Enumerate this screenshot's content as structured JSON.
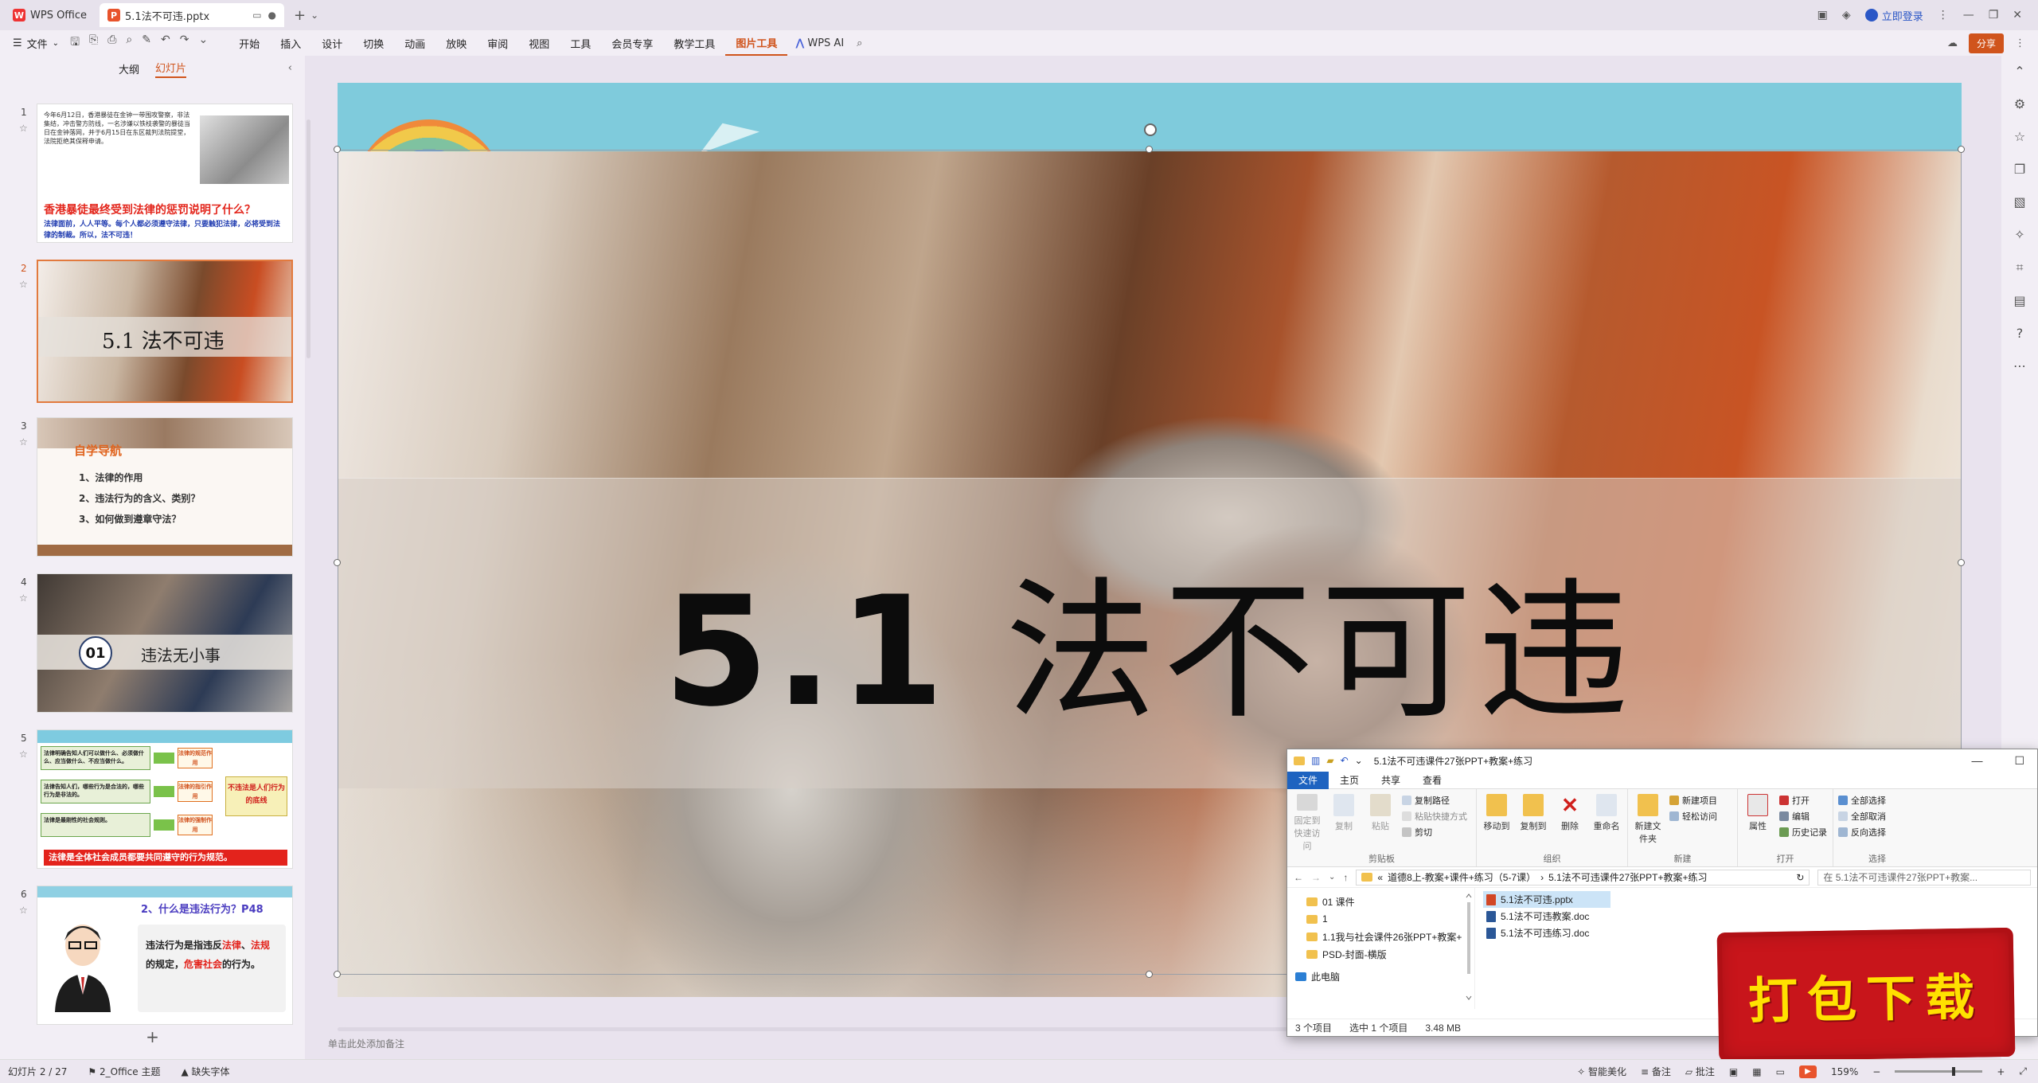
{
  "tabbar": {
    "app_tab": "WPS Office",
    "doc_tab": "5.1法不可违.pptx",
    "login": "立即登录"
  },
  "menubar": {
    "file": "文件",
    "items": [
      "开始",
      "插入",
      "设计",
      "切换",
      "动画",
      "放映",
      "审阅",
      "视图",
      "工具",
      "会员专享",
      "教学工具",
      "图片工具"
    ],
    "active_item": "图片工具",
    "ai": "WPS AI",
    "share": "分享"
  },
  "leftpanel": {
    "tab_outline": "大纲",
    "tab_slides": "幻灯片",
    "slides": [
      {
        "num": "1",
        "body": "今年6月12日，香港暴徒在金钟一带围攻警察，非法集结，冲击警方防线，一名涉嫌以铁枝袭警的暴徒当日在金钟落网，并于6月15日在东区裁判法院提堂，法院拒绝其保释申请。",
        "question": "香港暴徒最终受到法律的惩罚说明了什么？",
        "answer": "法律面前，人人平等。每个人都必须遵守法律，只要触犯法律，必将受到法律的制裁。所以，法不可违！"
      },
      {
        "num": "2",
        "title": "5.1 法不可违"
      },
      {
        "num": "3",
        "heading": "自学导航",
        "items": [
          "1、法律的作用",
          "2、违法行为的含义、类别？",
          "3、如何做到遵章守法？"
        ]
      },
      {
        "num": "4",
        "badge": "01",
        "label": "违法无小事"
      },
      {
        "num": "5",
        "boxes": [
          "法律明确告知人们可以做什么、必须做什么、应当做什么、不应当做什么。",
          "法律告知人们，哪些行为是合法的，哪些行为是非法的。",
          "法律是最刚性的社会规则。"
        ],
        "mids": [
          "法律的规范作用",
          "法律的指引作用",
          "法律的强制作用"
        ],
        "scroll": "不违法是人们行为的底线",
        "bottom": "法律是全体社会成员都要共同遵守的行为规范。"
      },
      {
        "num": "6",
        "heading": "2、什么是违法行为？P48",
        "card_pre": "违法行为是指违反",
        "card_red1": "法律",
        "card_mid": "、",
        "card_red2": "法规",
        "card_post": "的规定，",
        "card_red3": "危害社会",
        "card_end": "的行为。"
      }
    ],
    "add_slide": "+"
  },
  "slide": {
    "title_num": "5.1",
    "title_cn": "法不可违"
  },
  "editor": {
    "notes_placeholder": "单击此处添加备注"
  },
  "explorer": {
    "title": "5.1法不可违课件27张PPT+教案+练习",
    "tabs": [
      "文件",
      "主页",
      "共享",
      "查看"
    ],
    "groups": {
      "clipboard": {
        "label": "剪贴板",
        "pin": "固定到快速访问",
        "copy": "复制",
        "paste": "粘贴",
        "copy_path": "复制路径",
        "paste_shortcut": "粘贴快捷方式",
        "cut": "剪切"
      },
      "organize": {
        "label": "组织",
        "move_to": "移动到",
        "copy_to": "复制到",
        "delete": "删除",
        "rename": "重命名"
      },
      "new": {
        "label": "新建",
        "new_folder": "新建文件夹",
        "new_item": "新建项目",
        "easy_access": "轻松访问"
      },
      "open": {
        "label": "打开",
        "properties": "属性",
        "open": "打开",
        "edit": "编辑",
        "history": "历史记录"
      },
      "select": {
        "label": "选择",
        "select_all": "全部选择",
        "select_none": "全部取消",
        "invert": "反向选择"
      }
    },
    "address": {
      "root": "«",
      "crumb1": "道德8上-教案+课件+练习（5-7课）",
      "crumb2": "5.1法不可违课件27张PPT+教案+练习",
      "search_placeholder": "在 5.1法不可违课件27张PPT+教案..."
    },
    "nav": [
      "01 课件",
      "1",
      "1.1我与社会课件26张PPT+教案+",
      "PSD-封面-横版"
    ],
    "nav_pc": "此电脑",
    "files": [
      "5.1法不可违.pptx",
      "5.1法不可违教案.doc",
      "5.1法不可违练习.doc"
    ],
    "status_items": "3 个项目",
    "status_selected": "选中 1 个项目",
    "status_size": "3.48 MB"
  },
  "statusbar": {
    "slide_pos": "幻灯片 2 / 27",
    "theme": "2_Office 主题",
    "missing_font": "缺失字体",
    "beautify": "智能美化",
    "notes": "备注",
    "comments": "批注",
    "zoom": "159%"
  },
  "stamp": {
    "text": "打包下载"
  }
}
